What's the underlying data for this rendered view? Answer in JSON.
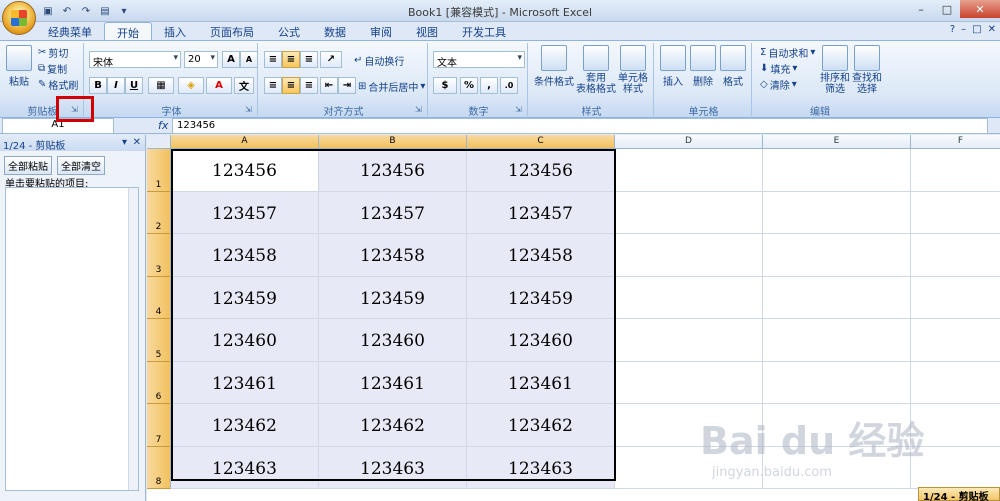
{
  "window": {
    "title": "Book1  [兼容模式] - Microsoft Excel",
    "qat": [
      "save-icon",
      "undo-icon",
      "redo-icon",
      "print-preview-icon"
    ]
  },
  "tabs": [
    "经典菜单",
    "开始",
    "插入",
    "页面布局",
    "公式",
    "数据",
    "审阅",
    "视图",
    "开发工具"
  ],
  "active_tab": "开始",
  "ribbon": {
    "clipboard": {
      "label": "剪贴板",
      "paste": "粘贴",
      "cut": "剪切",
      "copy": "复制",
      "format_painter": "格式刷"
    },
    "font": {
      "label": "字体",
      "font_name": "宋体",
      "font_size": "20",
      "grow": "A",
      "shrink": "A",
      "bold": "B",
      "italic": "I",
      "underline": "U"
    },
    "alignment": {
      "label": "对齐方式",
      "wrap": "自动换行",
      "merge": "合并后居中"
    },
    "number": {
      "label": "数字",
      "format": "文本",
      "percent": "%",
      "comma": ","
    },
    "styles": {
      "label": "样式",
      "conditional": "条件格式",
      "table": "套用\n表格格式",
      "cell_styles": "单元格\n样式"
    },
    "cells": {
      "label": "单元格",
      "insert": "插入",
      "delete": "删除",
      "format": "格式"
    },
    "editing": {
      "label": "编辑",
      "autosum": "自动求和",
      "fill": "填充",
      "clear": "清除",
      "sort": "排序和\n筛选",
      "find": "查找和\n选择"
    }
  },
  "formula_bar": {
    "name_box": "A1",
    "fx": "fx",
    "value": "123456"
  },
  "clipboard_pane": {
    "title": "1/24 - 剪贴板",
    "paste_all": "全部粘贴",
    "clear_all": "全部清空",
    "hint": "单击要粘贴的项目:"
  },
  "sheet": {
    "columns": [
      "A",
      "B",
      "C",
      "D",
      "E",
      "F"
    ],
    "rows": [
      "1",
      "2",
      "3",
      "4",
      "5",
      "6",
      "7",
      "8"
    ],
    "data": [
      [
        "123456",
        "123456",
        "123456"
      ],
      [
        "123457",
        "123457",
        "123457"
      ],
      [
        "123458",
        "123458",
        "123458"
      ],
      [
        "123459",
        "123459",
        "123459"
      ],
      [
        "123460",
        "123460",
        "123460"
      ],
      [
        "123461",
        "123461",
        "123461"
      ],
      [
        "123462",
        "123462",
        "123462"
      ],
      [
        "123463",
        "123463",
        "123463"
      ]
    ]
  },
  "status_button": "1/24 - 剪贴板",
  "watermark": {
    "main": "Bai du 经验",
    "sub": "jingyan.baidu.com"
  }
}
